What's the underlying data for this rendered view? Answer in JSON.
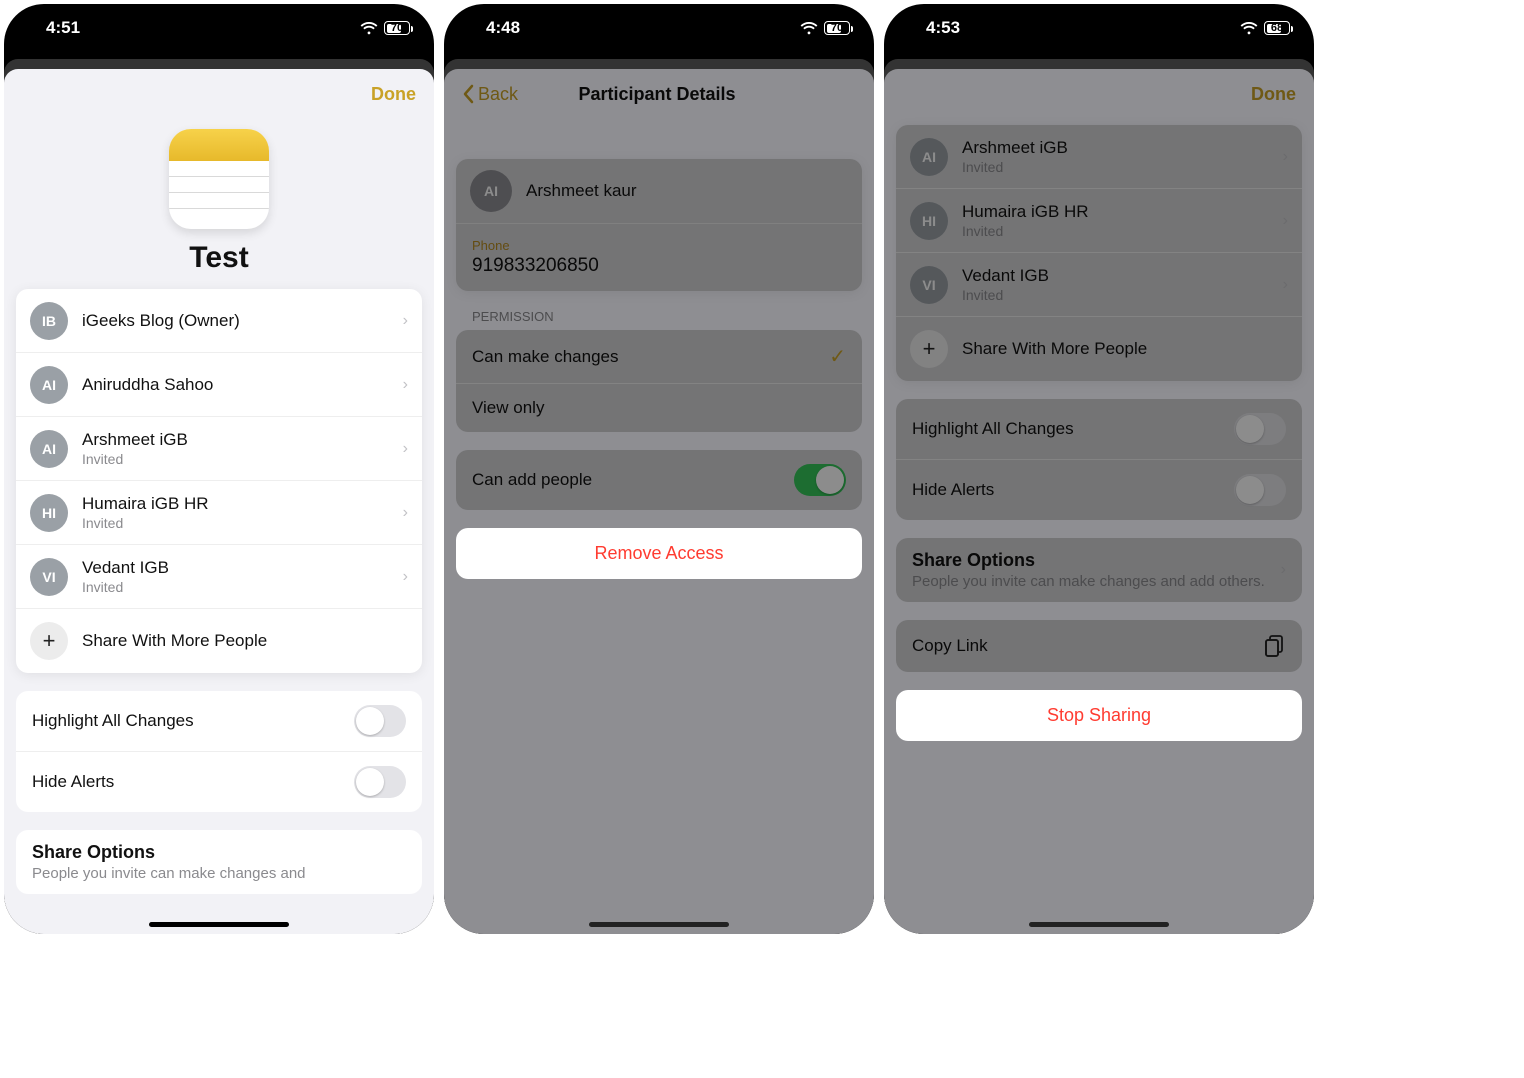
{
  "screen1": {
    "statusbar": {
      "time": "4:51",
      "battery": "70"
    },
    "nav": {
      "done": "Done"
    },
    "title": "Test",
    "participants": [
      {
        "initials": "IB",
        "name": "iGeeks Blog (Owner)",
        "sub": ""
      },
      {
        "initials": "AI",
        "name": "Aniruddha Sahoo",
        "sub": ""
      },
      {
        "initials": "AI",
        "name": "Arshmeet iGB",
        "sub": "Invited"
      },
      {
        "initials": "HI",
        "name": "Humaira iGB HR",
        "sub": "Invited"
      },
      {
        "initials": "VI",
        "name": "Vedant IGB",
        "sub": "Invited"
      }
    ],
    "share_more": "Share With More People",
    "toggles": {
      "highlight": "Highlight All Changes",
      "hide_alerts": "Hide Alerts"
    },
    "share_options": {
      "title": "Share Options",
      "sub": "People you invite can make changes and"
    }
  },
  "screen2": {
    "statusbar": {
      "time": "4:48",
      "battery": "70"
    },
    "nav": {
      "back": "Back",
      "title": "Participant Details"
    },
    "contact": {
      "initials": "AI",
      "name": "Arshmeet kaur"
    },
    "phone_label": "Phone",
    "phone_value": "919833206850",
    "permission_label": "PERMISSION",
    "perm_edit": "Can make changes",
    "perm_view": "View only",
    "can_add": "Can add people",
    "remove": "Remove Access"
  },
  "screen3": {
    "statusbar": {
      "time": "4:53",
      "battery": "68"
    },
    "nav": {
      "done": "Done"
    },
    "participants": [
      {
        "initials": "AI",
        "name": "Arshmeet iGB",
        "sub": "Invited"
      },
      {
        "initials": "HI",
        "name": "Humaira iGB HR",
        "sub": "Invited"
      },
      {
        "initials": "VI",
        "name": "Vedant IGB",
        "sub": "Invited"
      }
    ],
    "share_more": "Share With More People",
    "toggles": {
      "highlight": "Highlight All Changes",
      "hide_alerts": "Hide Alerts"
    },
    "share_options": {
      "title": "Share Options",
      "sub": "People you invite can make changes and add others."
    },
    "copy_link": "Copy Link",
    "stop_sharing": "Stop Sharing"
  }
}
